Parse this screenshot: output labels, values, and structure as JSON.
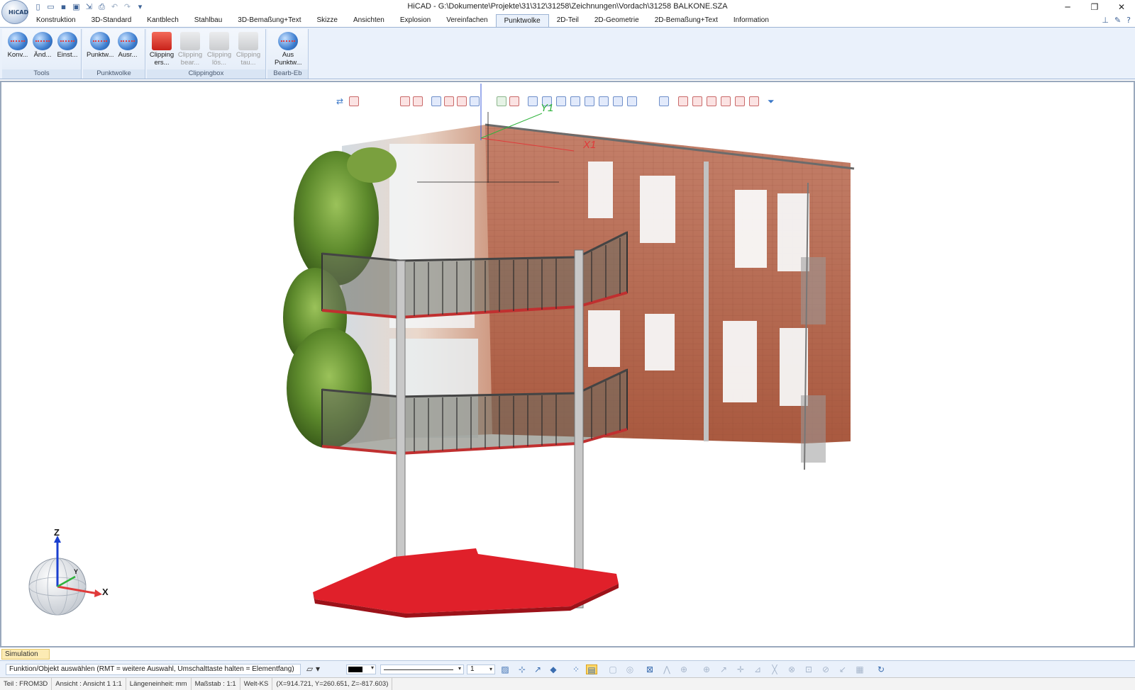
{
  "window": {
    "title": "HiCAD - G:\\Dokumente\\Projekte\\31\\312\\31258\\Zeichnungen\\Vordach\\31258 BALKONE.SZA",
    "app_logo_text": "HiCAD",
    "controls": {
      "minimize": "─",
      "restore": "❐",
      "close": "✕"
    }
  },
  "quick_access": [
    {
      "name": "new-file-icon",
      "glyph": "▯"
    },
    {
      "name": "open-file-icon",
      "glyph": "▭"
    },
    {
      "name": "save-icon",
      "glyph": "▪"
    },
    {
      "name": "save-as-icon",
      "glyph": "▣"
    },
    {
      "name": "export-icon",
      "glyph": "⇲"
    },
    {
      "name": "print-icon",
      "glyph": "⎙"
    },
    {
      "name": "undo-icon",
      "glyph": "↶"
    },
    {
      "name": "redo-icon",
      "glyph": "↷"
    },
    {
      "name": "qat-customize-icon",
      "glyph": "▾"
    }
  ],
  "tabs": [
    "Konstruktion",
    "3D-Standard",
    "Kantblech",
    "Stahlbau",
    "3D-Bemaßung+Text",
    "Skizze",
    "Ansichten",
    "Explosion",
    "Vereinfachen",
    "Punktwolke",
    "2D-Teil",
    "2D-Geometrie",
    "2D-Bemaßung+Text",
    "Information"
  ],
  "active_tab": "Punktwolke",
  "tab_right_icons": [
    {
      "name": "pin-icon",
      "glyph": "⊥"
    },
    {
      "name": "notes-icon",
      "glyph": "✎"
    },
    {
      "name": "help-icon",
      "glyph": "?"
    }
  ],
  "ribbon": {
    "groups": [
      {
        "label": "Tools",
        "buttons": [
          {
            "label": "Konv...",
            "icon": "cloud",
            "enabled": true
          },
          {
            "label": "Änd...",
            "icon": "cloud",
            "enabled": true
          },
          {
            "label": "Einst...",
            "icon": "cloud",
            "enabled": true
          }
        ]
      },
      {
        "label": "Punktwolke",
        "buttons": [
          {
            "label": "Punktw...",
            "icon": "cloud",
            "enabled": true
          },
          {
            "label": "Ausr...",
            "icon": "cloud",
            "enabled": true
          }
        ]
      },
      {
        "label": "Clippingbox",
        "buttons": [
          {
            "label": "Clipping ers...",
            "icon": "clip",
            "enabled": true
          },
          {
            "label": "Clipping bear...",
            "icon": "clip",
            "enabled": false
          },
          {
            "label": "Clipping lös...",
            "icon": "clip",
            "enabled": false
          },
          {
            "label": "Clipping tau...",
            "icon": "clip",
            "enabled": false
          }
        ]
      },
      {
        "label": "Bearb-Eb",
        "buttons": [
          {
            "label": "Aus Punktw...",
            "icon": "cloud",
            "enabled": true
          }
        ]
      }
    ]
  },
  "viewport": {
    "axis_labels": {
      "x": "X1",
      "y": "Y1"
    },
    "coord_sphere": {
      "z": "Z",
      "x": "X",
      "y": "Y"
    }
  },
  "simulation_tab": "Simulation",
  "prompt_text": "Funktion/Objekt auswählen (RMT = weitere Auswahl, Umschalttaste halten = Elementfang)",
  "line_width_value": "1",
  "status": [
    "Teil : FROM3D",
    "Ansicht : Ansicht 1 1:1",
    "Längeneinheit: mm",
    "Maßstab : 1:1",
    "Welt-KS",
    "(X=914.721, Y=260.651, Z=-817.603)"
  ]
}
